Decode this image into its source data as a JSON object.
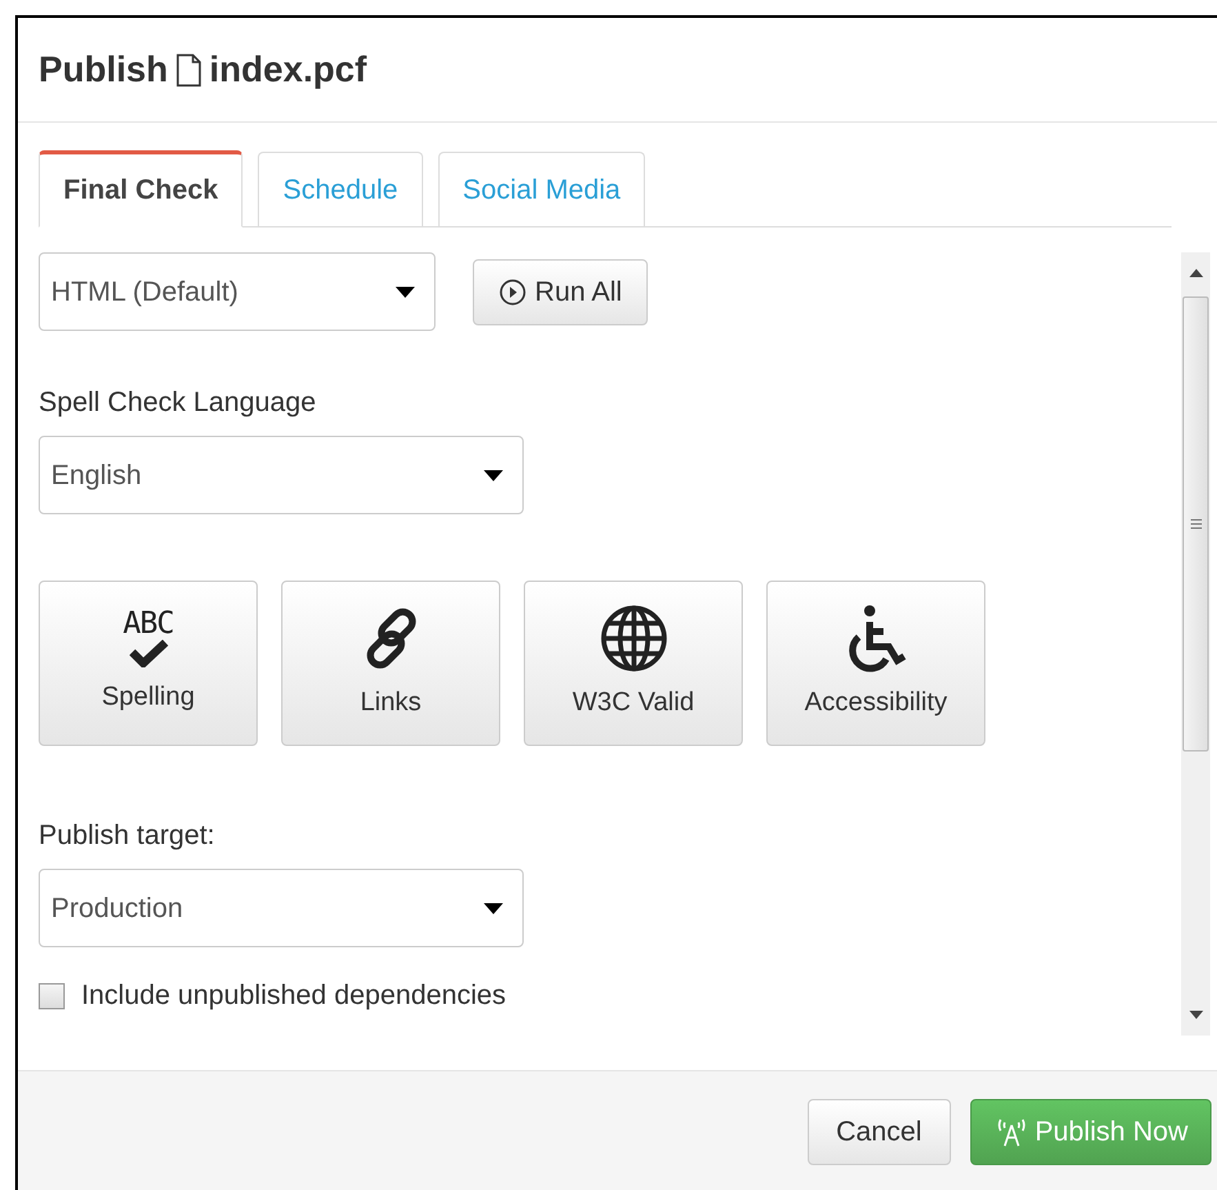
{
  "dialog": {
    "title_prefix": "Publish",
    "file_name": "index.pcf"
  },
  "tabs": [
    {
      "label": "Final Check",
      "selected": true
    },
    {
      "label": "Schedule",
      "selected": false
    },
    {
      "label": "Social Media",
      "selected": false
    }
  ],
  "format_select": {
    "value": "HTML (Default)"
  },
  "run_all_button": {
    "label": "Run All"
  },
  "spell_check": {
    "label": "Spell Check Language",
    "value": "English"
  },
  "checks": [
    {
      "kind": "spelling",
      "label": "Spelling",
      "icon_text": "ABC"
    },
    {
      "kind": "links",
      "label": "Links"
    },
    {
      "kind": "w3c",
      "label": "W3C Valid"
    },
    {
      "kind": "accessibility",
      "label": "Accessibility"
    }
  ],
  "publish_target": {
    "label": "Publish target:",
    "value": "Production"
  },
  "dependencies": {
    "label": "Include unpublished dependencies",
    "checked": false
  },
  "footer": {
    "cancel": "Cancel",
    "publish": "Publish Now"
  }
}
